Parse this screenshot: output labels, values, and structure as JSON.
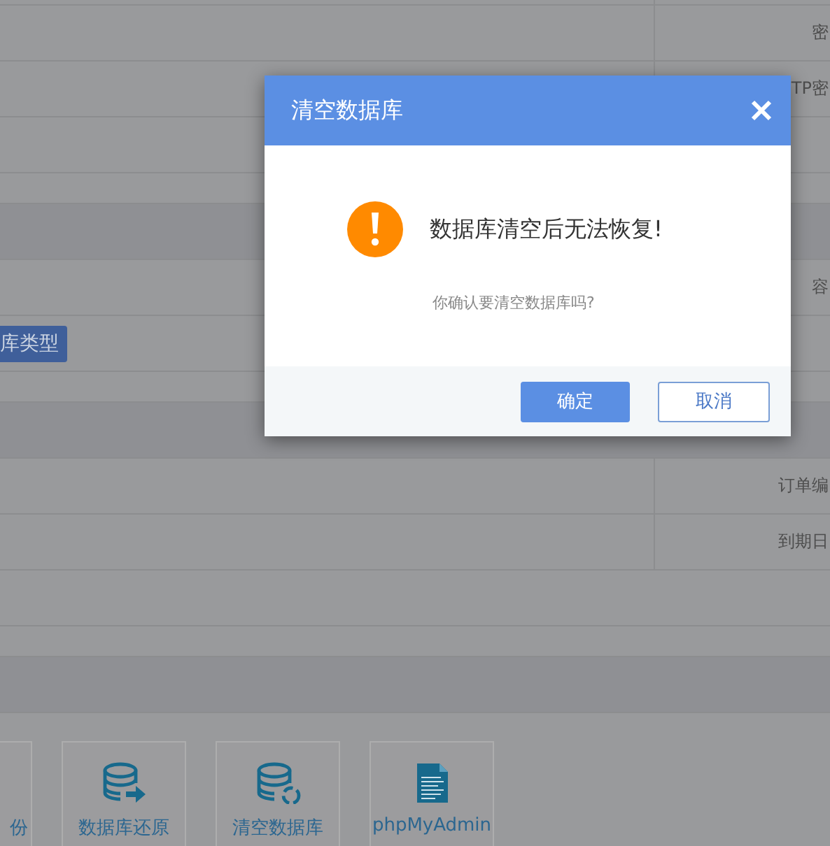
{
  "page": {
    "rows": [
      {
        "kind": "line"
      },
      {
        "kind": "field",
        "label": "密"
      },
      {
        "kind": "field",
        "label": "TP密"
      },
      {
        "kind": "field"
      },
      {
        "kind": "gap"
      },
      {
        "kind": "band"
      },
      {
        "kind": "field",
        "label": "容"
      },
      {
        "kind": "button",
        "button": "库类型"
      },
      {
        "kind": "gap"
      },
      {
        "kind": "band"
      },
      {
        "kind": "field",
        "label": "订单编"
      },
      {
        "kind": "field",
        "label": "到期日"
      },
      {
        "kind": "plain"
      },
      {
        "kind": "gap"
      },
      {
        "kind": "band"
      }
    ],
    "tiles": [
      {
        "kind": "partial",
        "label": "份"
      },
      {
        "kind": "restore",
        "label": "数据库还原"
      },
      {
        "kind": "clear",
        "label": "清空数据库"
      },
      {
        "kind": "php",
        "label": "phpMyAdmin"
      }
    ]
  },
  "dialog": {
    "title": "清空数据库",
    "message": "数据库清空后无法恢复!",
    "question": "你确认要清空数据库吗?",
    "buttons": [
      {
        "kind": "primary",
        "label": "确定"
      },
      {
        "kind": "secondary",
        "label": "取消"
      }
    ]
  }
}
